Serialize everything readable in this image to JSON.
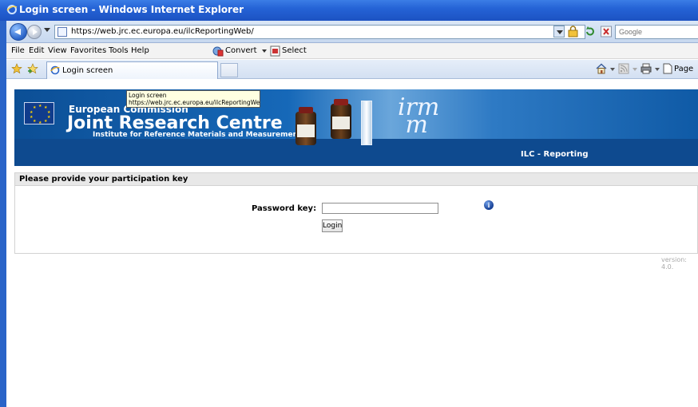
{
  "window": {
    "title": "Login screen - Windows Internet Explorer"
  },
  "address_bar": {
    "url": "https://web.jrc.ec.europa.eu/ilcReportingWeb/",
    "search_placeholder": "Google"
  },
  "menu": {
    "items": [
      "File",
      "Edit",
      "View",
      "Favorites",
      "Tools",
      "Help"
    ],
    "convert_label": "Convert",
    "select_label": "Select"
  },
  "tabs": {
    "active_label": "Login screen",
    "page_menu_label": "Page"
  },
  "tooltip": {
    "title": "Login screen",
    "url": "https://web.jrc.ec.europa.eu/ilcReportingWeb/"
  },
  "banner": {
    "line1": "European Commission",
    "line2": "Joint Research Centre",
    "line3": "Institute for Reference Materials and Measurements",
    "logo_text": "irm\nm",
    "app_name": "ILC - Reporting"
  },
  "login_panel": {
    "header": "Please provide your participation key",
    "password_label": "Password key:",
    "password_value": "",
    "login_button": "Login"
  },
  "footer": {
    "version": "version: 4.0."
  },
  "colors": {
    "title_bar": "#2563d6",
    "banner_blue": "#0e4a8f",
    "panel_header": "#e8e8e8"
  }
}
